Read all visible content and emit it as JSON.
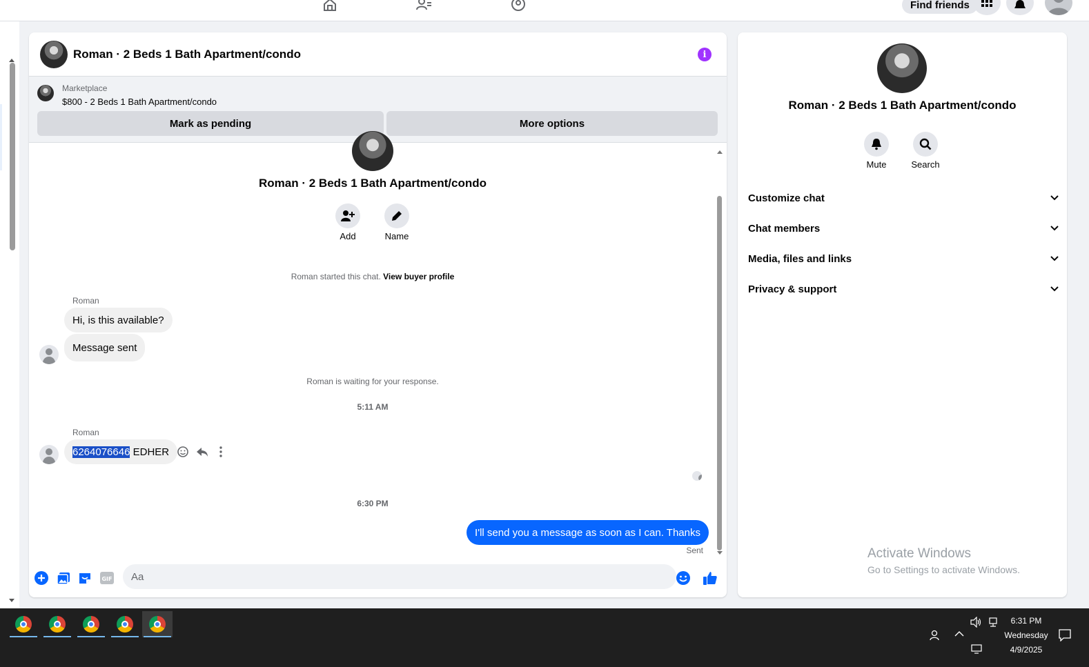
{
  "topnav": {
    "find_friends": "Find friends"
  },
  "chat": {
    "title": "Roman · 2 Beds 1 Bath Apartment/condo",
    "marketplace": {
      "label": "Marketplace",
      "listing": "$800 - 2 Beds 1 Bath Apartment/condo",
      "mark_pending": "Mark as pending",
      "more_options": "More options"
    },
    "intro": {
      "title": "Roman · 2 Beds 1 Bath Apartment/condo",
      "add_label": "Add",
      "name_label": "Name"
    },
    "started_note": "Roman started this chat.",
    "view_buyer_profile": "View buyer profile",
    "messages": {
      "sender1": "Roman",
      "msg1": "Hi, is this available?",
      "msg2": "Message sent",
      "waiting_note": "Roman is waiting for your response.",
      "time1": "5:11 AM",
      "sender2": "Roman",
      "msg3_selected": "6264076646",
      "msg3_rest": " EDHER",
      "time2": "6:30 PM",
      "my_msg": "I'll send you a message as soon as I can. Thanks",
      "status": "Sent"
    },
    "composer": {
      "placeholder": "Aa"
    }
  },
  "details": {
    "title": "Roman · 2 Beds 1 Bath Apartment/condo",
    "mute_label": "Mute",
    "search_label": "Search",
    "sections": [
      "Customize chat",
      "Chat members",
      "Media, files and links",
      "Privacy & support"
    ]
  },
  "watermark": {
    "line1": "Activate Windows",
    "line2": "Go to Settings to activate Windows."
  },
  "taskbar": {
    "time": "6:31 PM",
    "day": "Wednesday",
    "date": "4/9/2025"
  },
  "colors": {
    "accent": "#0866ff",
    "info": "#a033ff",
    "selection": "#1a4fc7"
  }
}
